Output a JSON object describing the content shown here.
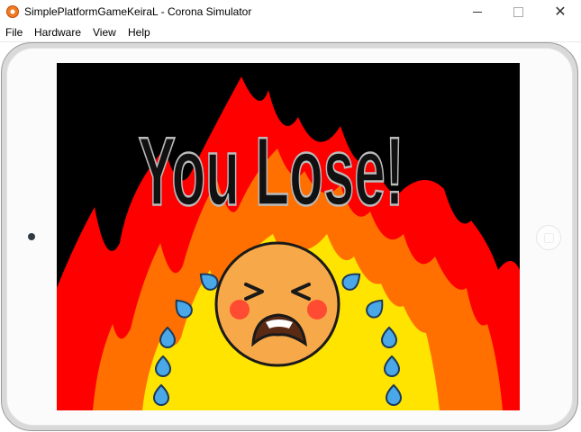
{
  "window": {
    "title": "SimplePlatformGameKeiraL - Corona Simulator",
    "icon": "corona-app-icon",
    "controls": [
      "minimize-icon",
      "maximize-icon",
      "close-icon"
    ]
  },
  "menu": {
    "items": [
      "File",
      "Hardware",
      "View",
      "Help"
    ]
  },
  "game": {
    "headline": "You Lose!",
    "colors": {
      "background": "#000000",
      "flame_outer": "#ff0000",
      "flame_mid": "#ff7000",
      "flame_inner": "#ffe400",
      "face": "#f7a94a",
      "tears": "#4aa7e8",
      "text_fill": "#111111",
      "text_outline": "#bbbbbb"
    }
  }
}
